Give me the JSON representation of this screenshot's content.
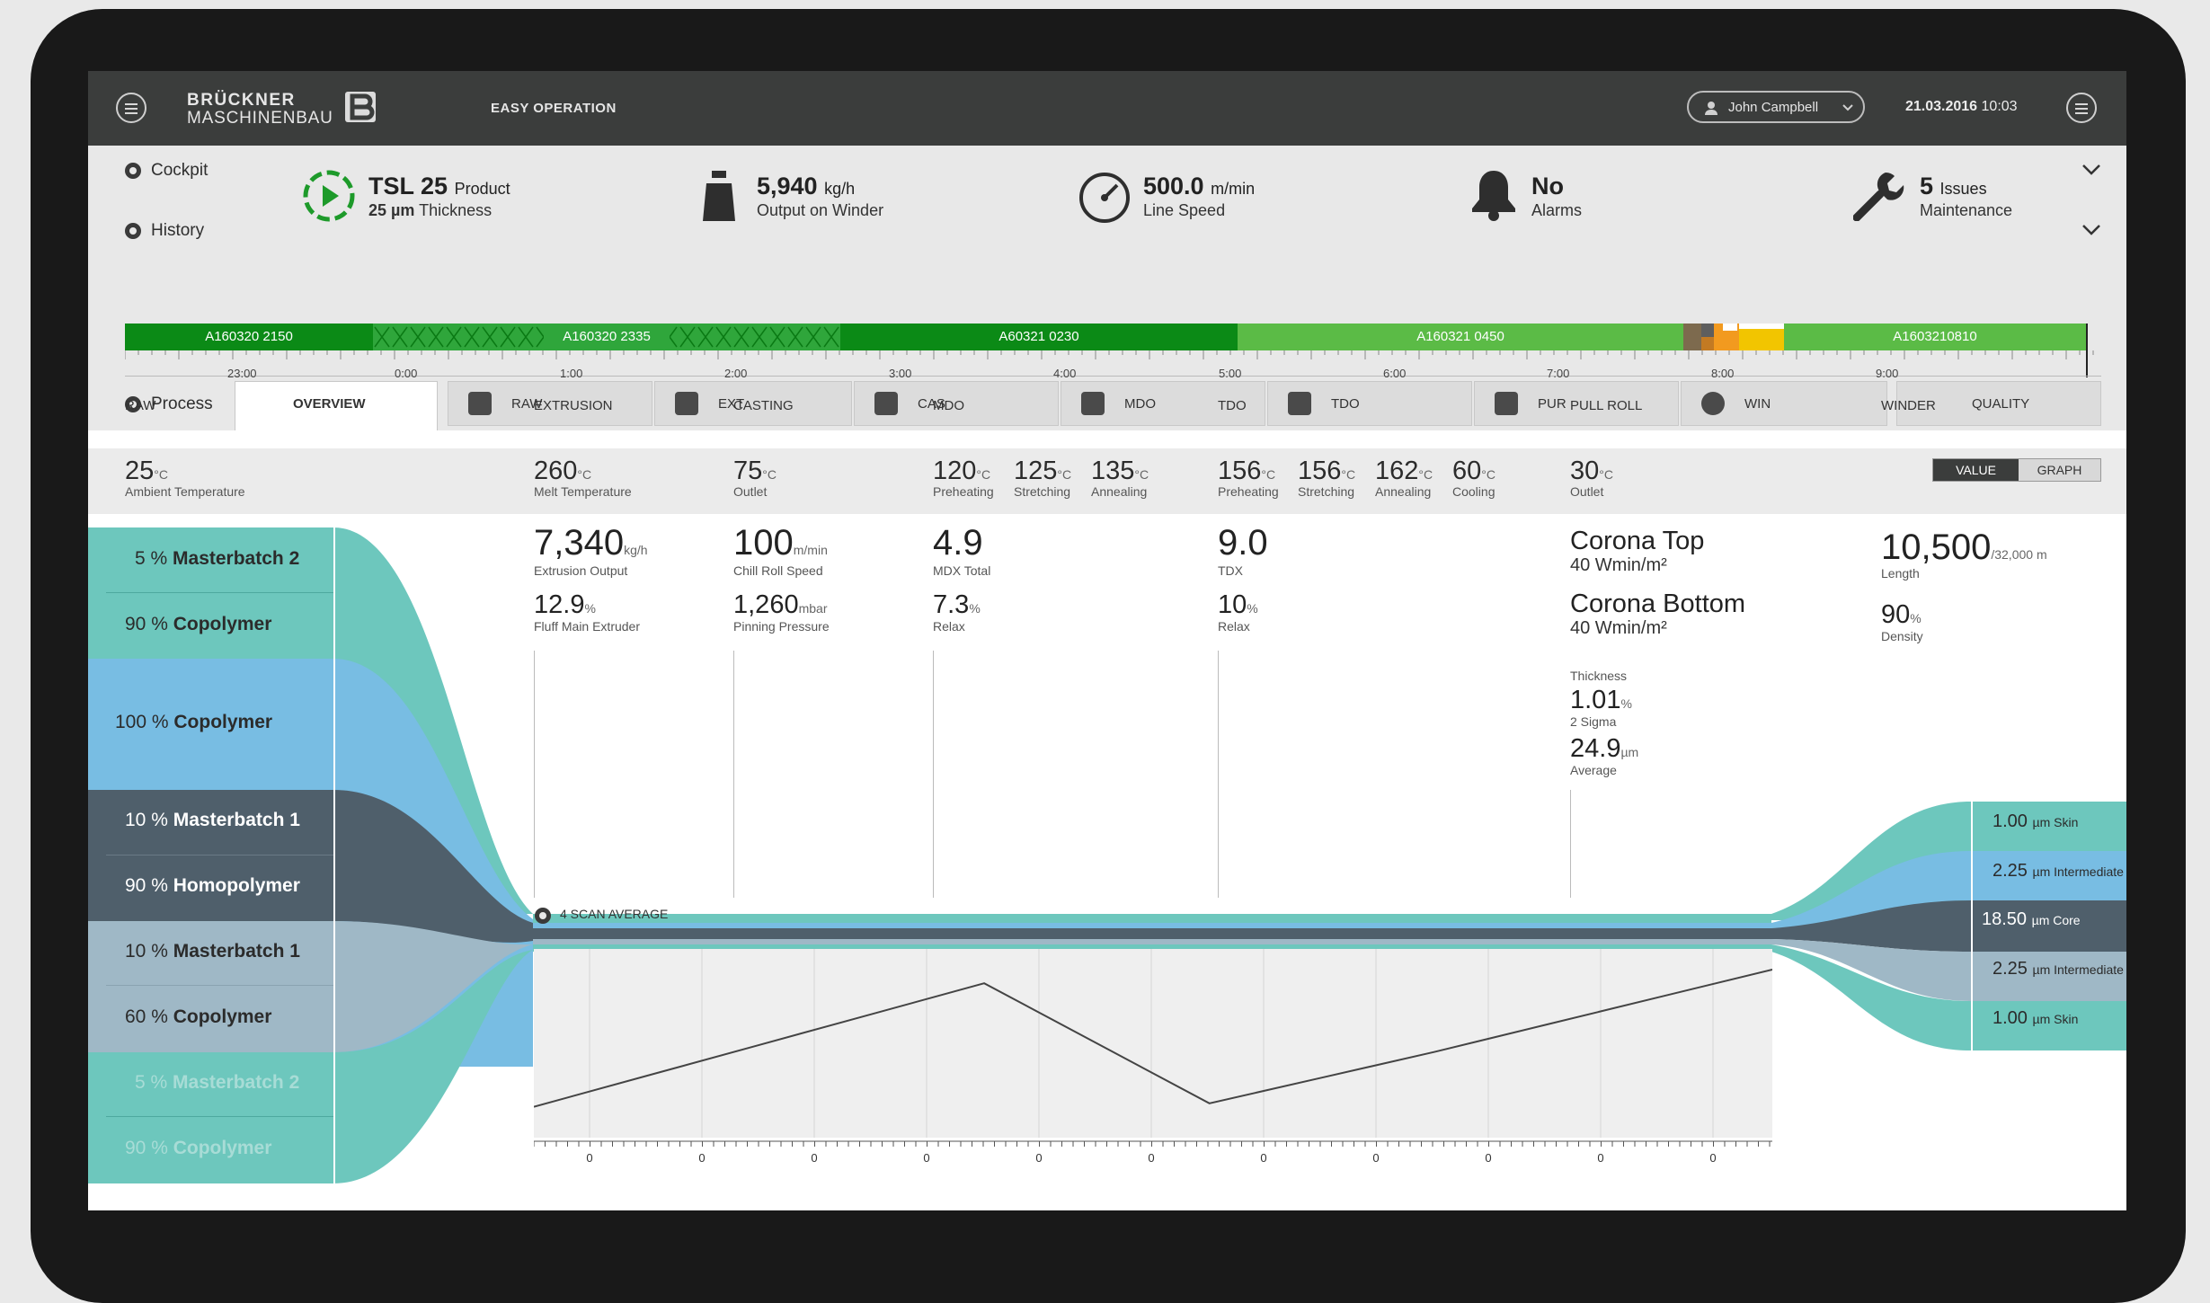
{
  "topbar": {
    "brand_line1": "BRÜCKNER",
    "brand_line2": "MASCHINENBAU",
    "mode_label": "EASY OPERATION",
    "user_name": "John Campbell",
    "date": "21.03.2016",
    "time": "10:03",
    "menu_icon": "menu-icon",
    "user_icon": "user-icon"
  },
  "cockpit": {
    "cockpit_label": "Cockpit",
    "history_label": "History",
    "product_value": "TSL 25",
    "product_unit": "Product",
    "product_sub_value": "25 µm",
    "product_sub_label": "Thickness",
    "output_value": "5,940",
    "output_unit": "kg/h",
    "output_label": "Output on Winder",
    "speed_value": "500.0",
    "speed_unit": "m/min",
    "speed_label": "Line Speed",
    "alarms_value": "No",
    "alarms_label": "Alarms",
    "issues_value": "5",
    "issues_unit": "Issues",
    "issues_label": "Maintenance"
  },
  "history": {
    "segments": [
      {
        "label": "A160320 2150",
        "color": "#0b8a16"
      },
      {
        "label": "A160320 2335",
        "color": "#2fa63b"
      },
      {
        "label": "A60321 0230",
        "color": "#0b8a16"
      },
      {
        "label": "A160321 0450",
        "color": "#5bbb46"
      },
      {
        "label": "",
        "color": "#f2a41e"
      },
      {
        "label": "A1603210810",
        "color": "#5bbb46"
      }
    ],
    "times": [
      "23:00",
      "0:00",
      "1:00",
      "2:00",
      "3:00",
      "4:00",
      "5:00",
      "6:00",
      "7:00",
      "8:00",
      "9:00"
    ]
  },
  "process": {
    "label": "Process",
    "tabs": [
      "OVERVIEW",
      "RAW",
      "EXT",
      "CAS",
      "MDO",
      "TDO",
      "PUR",
      "WIN",
      "QUALITY"
    ]
  },
  "sections": {
    "raw": "RAW",
    "extrusion": "EXTRUSION",
    "casting": "CASTING",
    "mdo": "MDO",
    "tdo": "TDO",
    "pullroll": "PULL ROLL",
    "winder": "WINDER"
  },
  "temps": {
    "ambient": {
      "value": "25",
      "unit": "°C",
      "label": "Ambient Temperature"
    },
    "melt": {
      "value": "260",
      "unit": "°C",
      "label": "Melt Temperature"
    },
    "outlet_cas": {
      "value": "75",
      "unit": "°C",
      "label": "Outlet"
    },
    "mdo_pre": {
      "value": "120",
      "unit": "°C",
      "label": "Preheating"
    },
    "mdo_str": {
      "value": "125",
      "unit": "°C",
      "label": "Stretching"
    },
    "mdo_ann": {
      "value": "135",
      "unit": "°C",
      "label": "Annealing"
    },
    "tdo_pre": {
      "value": "156",
      "unit": "°C",
      "label": "Preheating"
    },
    "tdo_str": {
      "value": "156",
      "unit": "°C",
      "label": "Stretching"
    },
    "tdo_ann": {
      "value": "162",
      "unit": "°C",
      "label": "Annealing"
    },
    "tdo_cool": {
      "value": "60",
      "unit": "°C",
      "label": "Cooling"
    },
    "pull_outlet": {
      "value": "30",
      "unit": "°C",
      "label": "Outlet"
    }
  },
  "view_toggle": {
    "value": "VALUE",
    "graph": "GRAPH"
  },
  "metrics": {
    "extrusion_output": {
      "value": "7,340",
      "unit": "kg/h",
      "label": "Extrusion Output"
    },
    "fluff": {
      "value": "12.9",
      "unit": "%",
      "label": "Fluff Main Extruder"
    },
    "chill": {
      "value": "100",
      "unit": "m/min",
      "label": "Chill Roll Speed"
    },
    "pinning": {
      "value": "1,260",
      "unit": "mbar",
      "label": "Pinning Pressure"
    },
    "mdx": {
      "value": "4.9",
      "label": "MDX Total"
    },
    "mdo_relax": {
      "value": "7.3",
      "unit": "%",
      "label": "Relax"
    },
    "tdx": {
      "value": "9.0",
      "label": "TDX"
    },
    "tdo_relax": {
      "value": "10",
      "unit": "%",
      "label": "Relax"
    },
    "corona_top": "Corona Top",
    "corona_top_val": "40 Wmin/m²",
    "corona_bottom": "Corona Bottom",
    "corona_bottom_val": "40 Wmin/m²",
    "thickness_label": "Thickness",
    "sigma": {
      "value": "1.01",
      "unit": "%",
      "label": "2 Sigma"
    },
    "average": {
      "value": "24.9",
      "unit": "µm",
      "label": "Average"
    },
    "length": {
      "value": "10,500",
      "unit": "/32,000 m",
      "label": "Length"
    },
    "density": {
      "value": "90",
      "unit": "%",
      "label": "Density"
    }
  },
  "materials": [
    {
      "pct": "5 %",
      "name": "Masterbatch 2"
    },
    {
      "pct": "90 %",
      "name": "Copolymer"
    },
    {
      "pct": "100 %",
      "name": "Copolymer"
    },
    {
      "pct": "10 %",
      "name": "Masterbatch 1"
    },
    {
      "pct": "90 %",
      "name": "Homopolymer"
    },
    {
      "pct": "10 %",
      "name": "Masterbatch 1"
    },
    {
      "pct": "60 %",
      "name": "Copolymer"
    },
    {
      "pct": "5 %",
      "name": "Masterbatch 2"
    },
    {
      "pct": "90 %",
      "name": "Copolymer"
    }
  ],
  "layers": [
    {
      "value": "1.00",
      "unit": "µm Skin"
    },
    {
      "value": "2.25",
      "unit": "µm Intermediate"
    },
    {
      "value": "18.50",
      "unit": "µm Core"
    },
    {
      "value": "2.25",
      "unit": "µm Intermediate"
    },
    {
      "value": "1.00",
      "unit": "µm Skin"
    }
  ],
  "scan": {
    "label": "4 SCAN AVERAGE"
  },
  "chart_data": {
    "type": "line",
    "title": "4 SCAN AVERAGE",
    "x": [
      0,
      1,
      2,
      3,
      4,
      5,
      6,
      7,
      8,
      9,
      10,
      11
    ],
    "x_tick_labels": [
      "0",
      "0",
      "0",
      "0",
      "0",
      "0",
      "0",
      "0",
      "0",
      "0",
      "0"
    ],
    "series": [
      {
        "values": [
          0.18,
          0.36,
          0.54,
          0.72,
          0.9,
          0.55,
          0.2,
          0.35,
          0.5,
          0.66,
          0.82,
          0.98
        ]
      }
    ],
    "ylim": [
      0,
      1.1
    ],
    "grid": "vertical"
  }
}
